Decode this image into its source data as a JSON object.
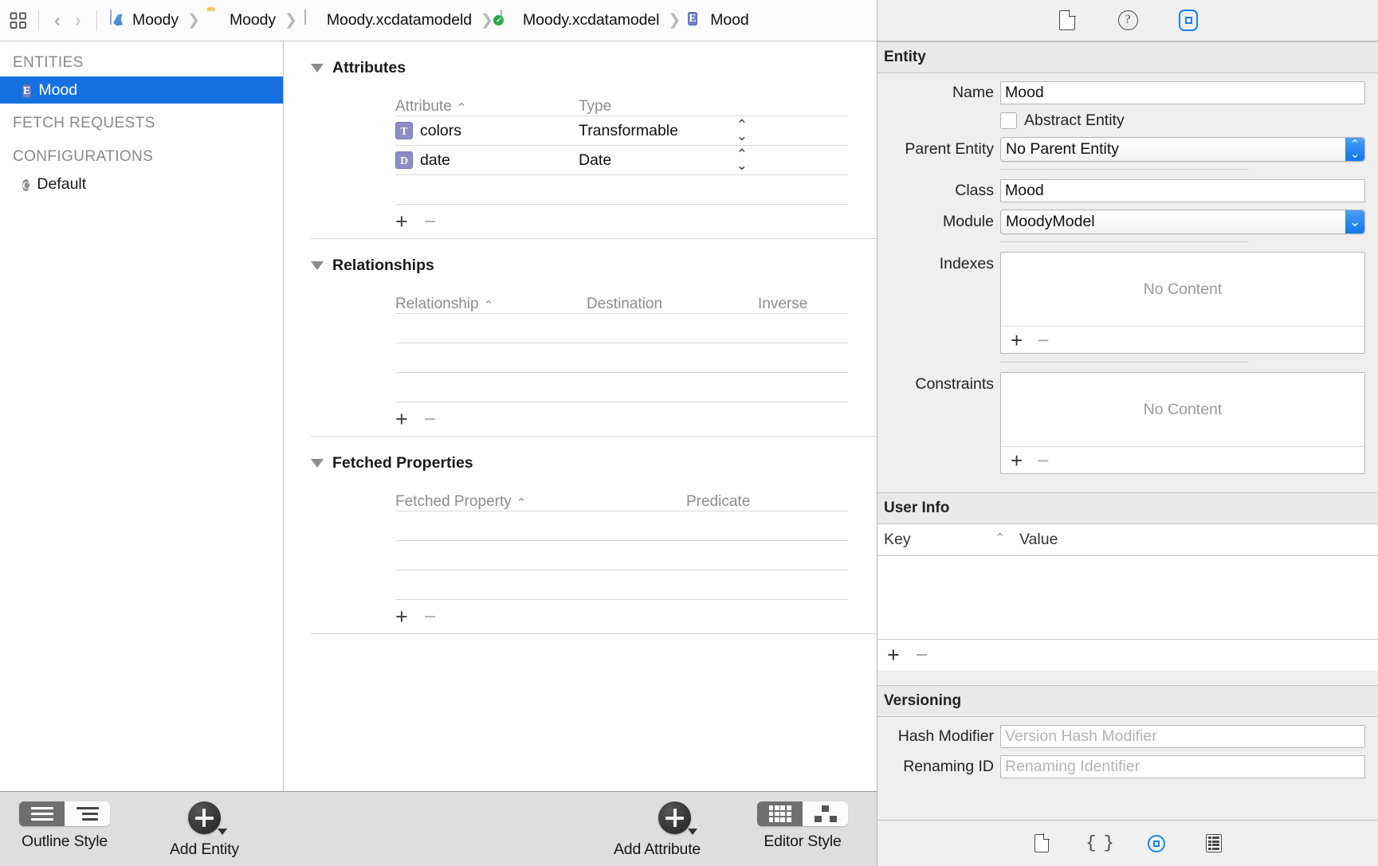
{
  "jumpbar": {
    "grid_icon": "grid-icon",
    "back_label": "‹",
    "forward_label": "›",
    "crumbs": [
      {
        "label": "Moody",
        "icon": "swift-project-icon"
      },
      {
        "label": "Moody",
        "icon": "folder-icon"
      },
      {
        "label": "Moody.xcdatamodeld",
        "icon": "datamodel-bundle-icon"
      },
      {
        "label": "Moody.xcdatamodel",
        "icon": "datamodel-version-icon"
      },
      {
        "label": "Mood",
        "icon": "entity-icon"
      }
    ],
    "separator": "❯"
  },
  "outline": {
    "groups": [
      {
        "title": "ENTITIES",
        "items": [
          {
            "label": "Mood",
            "badge": "E",
            "selected": true
          }
        ]
      },
      {
        "title": "FETCH REQUESTS",
        "items": []
      },
      {
        "title": "CONFIGURATIONS",
        "items": [
          {
            "label": "Default",
            "badge": "C",
            "selected": false
          }
        ]
      }
    ]
  },
  "canvas": {
    "attributes": {
      "title": "Attributes",
      "columns": [
        "Attribute",
        "Type"
      ],
      "sort_caret": "⌃",
      "rows": [
        {
          "badge": "T",
          "name": "colors",
          "type": "Transformable"
        },
        {
          "badge": "D",
          "name": "date",
          "type": "Date"
        }
      ],
      "empty_rows": 1,
      "add_label": "+",
      "remove_label": "−"
    },
    "relationships": {
      "title": "Relationships",
      "columns": [
        "Relationship",
        "Destination",
        "Inverse"
      ],
      "sort_caret": "⌃",
      "rows": [],
      "empty_rows": 3,
      "add_label": "+",
      "remove_label": "−"
    },
    "fetched_properties": {
      "title": "Fetched Properties",
      "columns": [
        "Fetched Property",
        "Predicate"
      ],
      "sort_caret": "⌃",
      "rows": [],
      "empty_rows": 3,
      "add_label": "+",
      "remove_label": "−"
    }
  },
  "bottombar": {
    "outline_style": {
      "label": "Outline Style",
      "options": [
        "flat",
        "indented"
      ],
      "selected_index": 0
    },
    "add_entity": {
      "label": "Add Entity"
    },
    "add_attribute": {
      "label": "Add Attribute"
    },
    "editor_style": {
      "label": "Editor Style",
      "options": [
        "table",
        "graph"
      ],
      "selected_index": 0
    }
  },
  "inspector": {
    "tabs": [
      {
        "icon": "file-inspector-icon",
        "selected": false
      },
      {
        "icon": "quick-help-icon",
        "selected": false
      },
      {
        "icon": "data-model-inspector-icon",
        "selected": true
      }
    ],
    "entity": {
      "heading": "Entity",
      "name_label": "Name",
      "name_value": "Mood",
      "abstract_label": "Abstract Entity",
      "abstract_checked": false,
      "parent_label": "Parent Entity",
      "parent_value": "No Parent Entity",
      "class_label": "Class",
      "class_value": "Mood",
      "module_label": "Module",
      "module_value": "MoodyModel",
      "indexes_label": "Indexes",
      "indexes_empty": "No Content",
      "constraints_label": "Constraints",
      "constraints_empty": "No Content",
      "add_label": "+",
      "remove_label": "−"
    },
    "user_info": {
      "heading": "User Info",
      "columns": [
        "Key",
        "Value"
      ],
      "sort_caret": "⌃",
      "rows": [],
      "add_label": "+",
      "remove_label": "−"
    },
    "versioning": {
      "heading": "Versioning",
      "hash_label": "Hash Modifier",
      "hash_placeholder": "Version Hash Modifier",
      "hash_value": "",
      "renaming_label": "Renaming ID",
      "renaming_placeholder": "Renaming Identifier",
      "renaming_value": ""
    },
    "bottom_tabs": [
      {
        "icon": "file-template-icon",
        "selected": false
      },
      {
        "icon": "code-snippet-icon",
        "selected": false
      },
      {
        "icon": "object-library-icon",
        "selected": true
      },
      {
        "icon": "media-library-icon",
        "selected": false
      }
    ]
  },
  "colors": {
    "accent": "#1571e0",
    "popup_blue": "#1177ec",
    "entity_badge": "#6d7fc9",
    "attribute_badge": "#8d8cc4",
    "toolbar_bg": "#dedede",
    "inspector_bg": "#efefef"
  }
}
